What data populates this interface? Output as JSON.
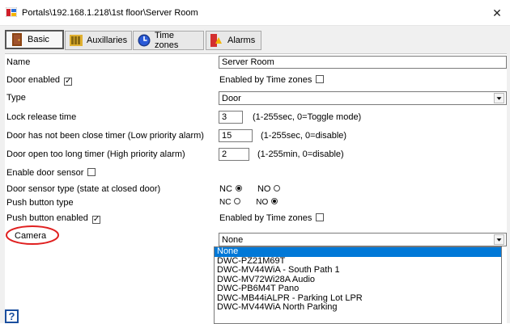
{
  "window": {
    "title": "Portals\\192.168.1.218\\1st floor\\Server Room",
    "close_glyph": "✕"
  },
  "tabs": [
    {
      "label": "Basic",
      "icon": "door-icon",
      "active": true
    },
    {
      "label": "Auxillaries",
      "icon": "auxillaries-icon",
      "active": false
    },
    {
      "label": "Time zones",
      "icon": "clock-icon",
      "active": false
    },
    {
      "label": "Alarms",
      "icon": "alarm-icon",
      "active": false
    }
  ],
  "form": {
    "name": {
      "label": "Name",
      "value": "Server Room"
    },
    "door_enabled": {
      "label": "Door enabled",
      "checked": true
    },
    "door_enabled_tz": {
      "label": "Enabled by Time zones",
      "checked": false
    },
    "type": {
      "label": "Type",
      "value": "Door"
    },
    "lock_release": {
      "label": "Lock release time",
      "value": "3",
      "hint": "(1-255sec, 0=Toggle mode)"
    },
    "close_timer": {
      "label": "Door has not been close timer (Low priority alarm)",
      "value": "15",
      "hint": "(1-255sec, 0=disable)"
    },
    "open_timer": {
      "label": "Door open too long timer (High priority alarm)",
      "value": "2",
      "hint": "(1-255min, 0=disable)"
    },
    "door_sensor": {
      "label": "Enable door sensor",
      "checked": false
    },
    "sensor_type": {
      "label": "Door sensor type (state at closed door)",
      "nc_label": "NC",
      "no_label": "NO",
      "selected": "NC"
    },
    "push_type": {
      "label": "Push button type",
      "nc_label": "NC",
      "no_label": "NO",
      "selected": "NO"
    },
    "push_enabled": {
      "label": "Push button enabled",
      "checked": true
    },
    "push_enabled_tz": {
      "label": "Enabled by Time zones",
      "checked": false
    },
    "camera": {
      "label": "Camera",
      "value": "None",
      "options": [
        "None",
        "DWC-PZ21M69T",
        "DWC-MV44WiA - South Path 1",
        "DWC-MV72Wi28A Audio",
        "DWC-PB6M4T Pano",
        "DWC-MB44iALPR - Parking Lot LPR",
        "DWC-MV44WiA North Parking"
      ],
      "highlighted": "None"
    }
  },
  "help": {
    "label": "?"
  },
  "colors": {
    "selection": "#0078d7",
    "annotation": "#e02020"
  },
  "check_glyph": "✓"
}
